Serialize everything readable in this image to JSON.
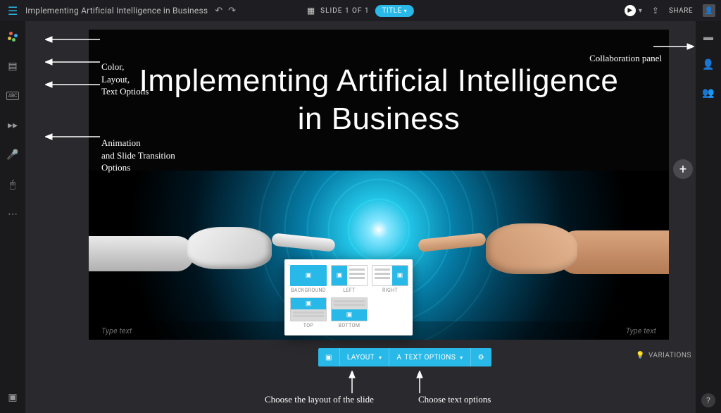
{
  "header": {
    "doc_title": "Implementing Artificial Intelligence in Business",
    "slide_counter": "SLIDE 1 OF 1",
    "title_pill": "TITLE",
    "share": "SHARE"
  },
  "left_tools": {
    "abc": "ABC"
  },
  "slide": {
    "hero_title": "Implementing Artificial Intelligence in Business",
    "footer_left": "Type text",
    "footer_right": "Type text"
  },
  "layout_popover": {
    "options": [
      {
        "key": "background",
        "label": "BACKGROUND"
      },
      {
        "key": "left",
        "label": "LEFT"
      },
      {
        "key": "right",
        "label": "RIGHT"
      },
      {
        "key": "top",
        "label": "TOP"
      },
      {
        "key": "bottom",
        "label": "BOTTOM"
      }
    ]
  },
  "bottom_toolbar": {
    "layout": "LAYOUT",
    "text_options": "TEXT OPTIONS"
  },
  "variations_label": "VARIATIONS",
  "annotations": {
    "left_group1_l1": "Color,",
    "left_group1_l2": "Layout,",
    "left_group1_l3": "Text Options",
    "left_group2_l1": "Animation",
    "left_group2_l2": "and Slide Transition",
    "left_group2_l3": "Options",
    "right_panel": "Collaboration panel",
    "bottom_layout": "Choose the layout of the slide",
    "bottom_text": "Choose text options"
  },
  "colors": {
    "accent": "#29b9e8",
    "bg_dark": "#1a1a1d",
    "bg_medium": "#2a2a2e"
  }
}
